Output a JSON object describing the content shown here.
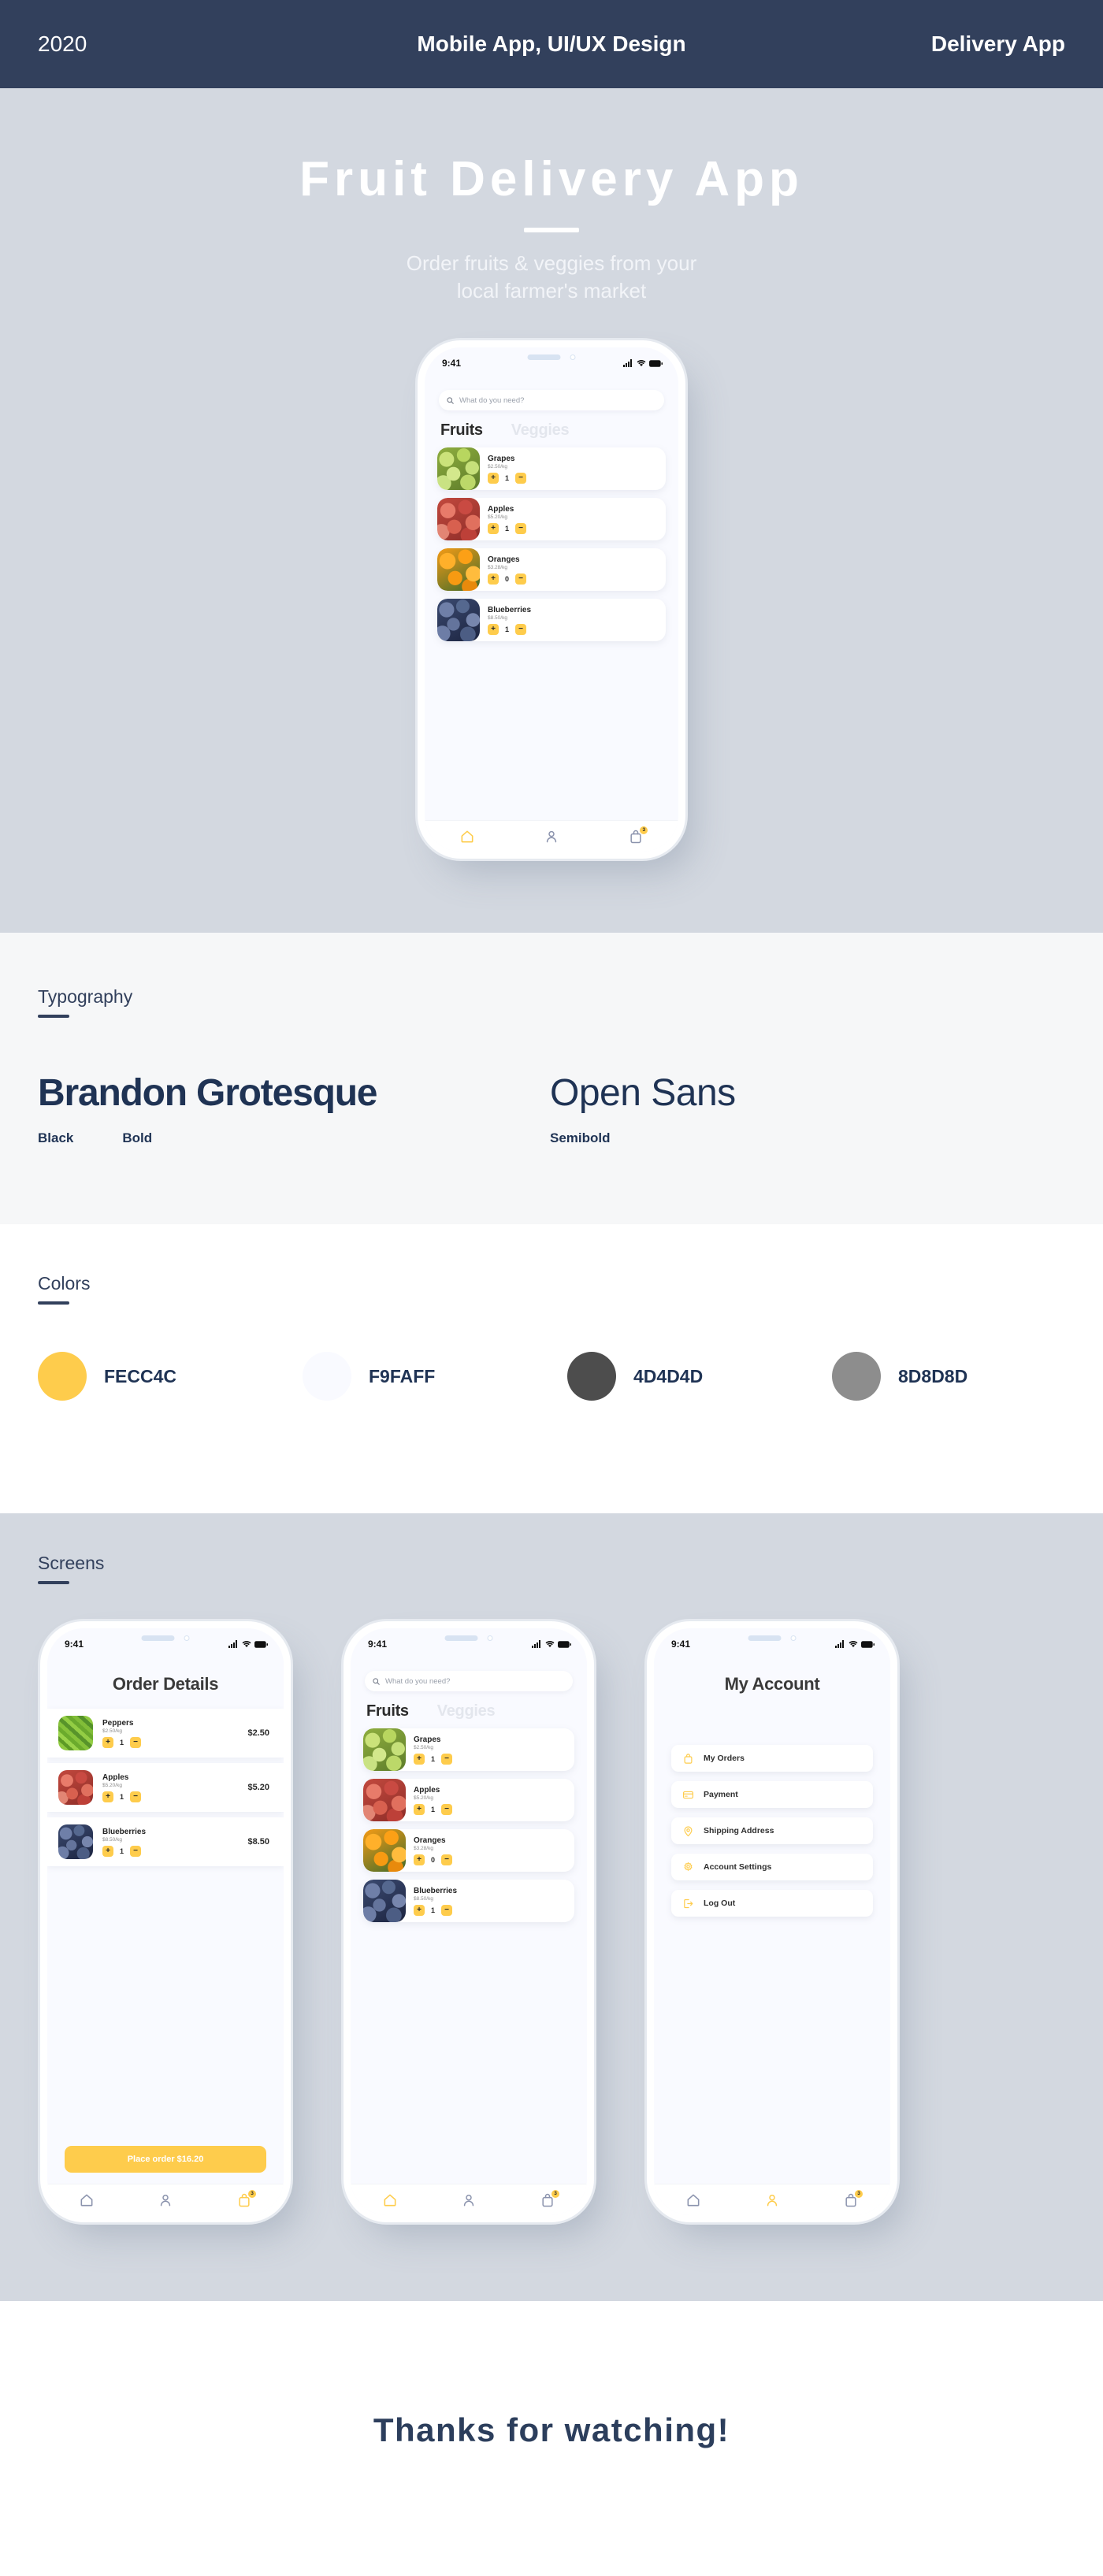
{
  "topbar": {
    "year": "2020",
    "category": "Mobile App, UI/UX Design",
    "project": "Delivery App"
  },
  "hero": {
    "title": "Fruit Delivery App",
    "subtitle_line1": "Order fruits & veggies from your",
    "subtitle_line2": "local farmer's market"
  },
  "phone_common": {
    "status_time": "9:41",
    "search_placeholder": "What do you need?",
    "tab_active": "Fruits",
    "tab_inactive": "Veggies",
    "cart_badge": "3",
    "nav": {
      "home": "home-icon",
      "account": "person-icon",
      "cart": "bag-icon"
    }
  },
  "fruits_screen": {
    "items": [
      {
        "name": "Grapes",
        "price": "$2.50/kg",
        "qty": "1",
        "plus": "+",
        "minus": "−",
        "image": "grapes"
      },
      {
        "name": "Apples",
        "price": "$5.20/kg",
        "qty": "1",
        "plus": "+",
        "minus": "−",
        "image": "apples"
      },
      {
        "name": "Oranges",
        "price": "$3.28/kg",
        "qty": "0",
        "plus": "+",
        "minus": "−",
        "image": "oranges"
      },
      {
        "name": "Blueberries",
        "price": "$8.50/kg",
        "qty": "1",
        "plus": "+",
        "minus": "−",
        "image": "blueberries"
      }
    ]
  },
  "typography": {
    "label": "Typography",
    "font1": {
      "name": "Brandon Grotesque",
      "weights": [
        "Black",
        "Bold"
      ]
    },
    "font2": {
      "name": "Open Sans",
      "weights": [
        "Semibold"
      ]
    }
  },
  "colors": {
    "label": "Colors",
    "swatches": [
      {
        "hex": "FECC4C",
        "value": "#FECC4C"
      },
      {
        "hex": "F9FAFF",
        "value": "#F9FAFF"
      },
      {
        "hex": "4D4D4D",
        "value": "#4D4D4D"
      },
      {
        "hex": "8D8D8D",
        "value": "#8D8D8D"
      }
    ]
  },
  "screens": {
    "label": "Screens",
    "order_details": {
      "title": "Order Details",
      "items": [
        {
          "name": "Peppers",
          "price": "$2.50/kg",
          "qty": "1",
          "total": "$2.50",
          "plus": "+",
          "minus": "−",
          "image": "peppers"
        },
        {
          "name": "Apples",
          "price": "$5.20/kg",
          "qty": "1",
          "total": "$5.20",
          "plus": "+",
          "minus": "−",
          "image": "apples"
        },
        {
          "name": "Blueberries",
          "price": "$8.50/kg",
          "qty": "1",
          "total": "$8.50",
          "plus": "+",
          "minus": "−",
          "image": "blueberries"
        }
      ],
      "place_order": "Place order $16.20"
    },
    "my_account": {
      "title": "My Account",
      "menu": [
        {
          "label": "My Orders",
          "icon": "bag-icon"
        },
        {
          "label": "Payment",
          "icon": "credit-card-icon"
        },
        {
          "label": "Shipping Address",
          "icon": "location-pin-icon"
        },
        {
          "label": "Account Settings",
          "icon": "gear-icon"
        },
        {
          "label": "Log Out",
          "icon": "logout-icon"
        }
      ]
    }
  },
  "footer": {
    "text": "Thanks for watching!"
  }
}
